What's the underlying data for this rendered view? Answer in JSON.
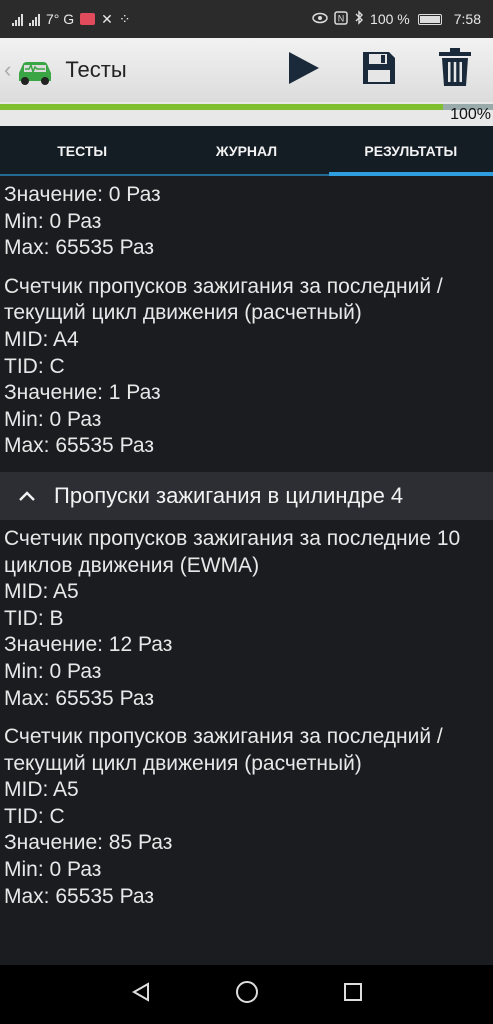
{
  "status_bar": {
    "left_text": "7° G",
    "battery_percent": "100 %",
    "time": "7:58",
    "icons": [
      "signal-icon",
      "signal-icon",
      "notification-app-icon",
      "tools-icon",
      "dots-icon",
      "eye-icon",
      "nfc-icon",
      "bluetooth-icon",
      "battery-icon"
    ]
  },
  "action_bar": {
    "title": "Тесты",
    "logo_icon": "car-diagnostic-logo-icon",
    "actions": [
      {
        "icon": "play-icon"
      },
      {
        "icon": "save-icon"
      },
      {
        "icon": "trash-icon"
      }
    ]
  },
  "progress": {
    "label": "100%",
    "value": 1.0,
    "color": "#7fbf2f"
  },
  "tabs": [
    {
      "label": "ТЕСТЫ",
      "active": false
    },
    {
      "label": "ЖУРНАЛ",
      "active": false
    },
    {
      "label": "РЕЗУЛЬТАТЫ",
      "active": true
    }
  ],
  "results": {
    "top_partial": {
      "lines": [
        "Значение: 0 Раз",
        "Min: 0 Раз",
        "Max: 65535 Раз"
      ]
    },
    "block1": {
      "title": "Счетчик пропусков зажигания за последний / текущий цикл движения (расчетный)",
      "lines": [
        "MID: A4",
        "TID: C",
        "Значение: 1 Раз",
        "Min: 0 Раз",
        "Max: 65535 Раз"
      ]
    },
    "section": {
      "label": "Пропуски зажигания в цилиндре 4"
    },
    "block2": {
      "title": "Счетчик пропусков зажигания за последние 10 циклов движения (EWMA)",
      "lines": [
        "MID: A5",
        "TID: B",
        "Значение: 12 Раз",
        "Min: 0 Раз",
        "Max: 65535 Раз"
      ]
    },
    "block3": {
      "title": "Счетчик пропусков зажигания за последний / текущий цикл движения (расчетный)",
      "lines": [
        "MID: A5",
        "TID: C",
        "Значение: 85 Раз",
        "Min: 0 Раз",
        "Max: 65535 Раз"
      ]
    }
  },
  "nav_bar": {
    "buttons": [
      "back-icon",
      "home-icon",
      "recents-icon"
    ]
  },
  "colors": {
    "accent": "#2f9fe0",
    "content_bg": "#1a1c1f",
    "section_bg": "#2c2e33"
  }
}
